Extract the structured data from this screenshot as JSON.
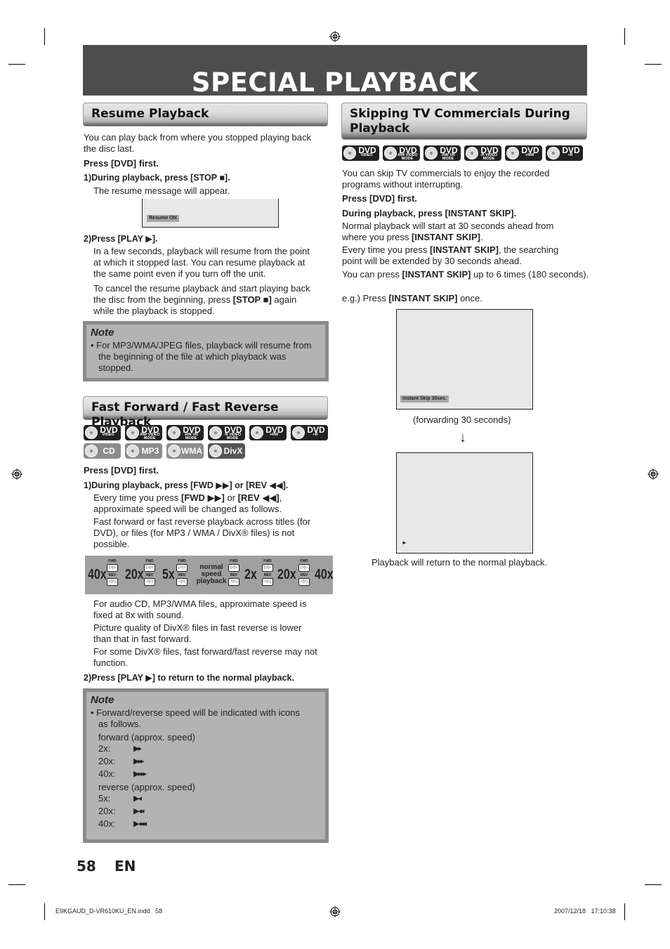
{
  "page": {
    "title": "SPECIAL PLAYBACK",
    "page_number": "58",
    "language": "EN"
  },
  "footer": {
    "file": "E9KGAUD_D-VR610KU_EN.indd   58",
    "timestamp": "2007/12/18   17:10:38"
  },
  "resume": {
    "heading": "Resume Playback",
    "intro_1": "You can play back from where you stopped playing back",
    "intro_2": "the disc last.",
    "press_first": "Press [DVD] first.",
    "step1": "1)During playback, press [STOP ■].",
    "step1_desc": "The resume message will appear.",
    "osd": "Resume ON",
    "step2": "2)Press [PLAY ▶].",
    "step2_desc": [
      "In a few seconds, playback will resume from the point",
      "at which it stopped last. You can resume playback at",
      "the same point even if you turn off the unit."
    ],
    "cancel_1": "To cancel the resume playback and start playing back",
    "cancel_2a": "the disc from the beginning, press ",
    "cancel_2b": "[STOP ■]",
    "cancel_2c": " again",
    "cancel_3": "while the playback is stopped.",
    "note_title": "Note",
    "note_lines": [
      "• For MP3/WMA/JPEG files, playback will resume from",
      "the beginning of the file at which playback was",
      "stopped."
    ]
  },
  "ffwd": {
    "heading": "Fast Forward / Fast Reverse Playback",
    "discs_row1": [
      {
        "label": "DVD",
        "sub": "VIDEO"
      },
      {
        "label": "DVD",
        "sub": "-RW VIDEO MODE"
      },
      {
        "label": "DVD",
        "sub": "-RW VR MODE"
      },
      {
        "label": "DVD",
        "sub": "-R VIDEO MODE"
      },
      {
        "label": "DVD",
        "sub": "+RW"
      },
      {
        "label": "DVD",
        "sub": "+R"
      }
    ],
    "discs_row2": [
      {
        "label": "CD"
      },
      {
        "label": "MP3"
      },
      {
        "label": "WMA"
      },
      {
        "label": "DivX"
      }
    ],
    "press_first": "Press [DVD] first.",
    "step1": "1)During playback, press [FWD ▶▶] or [REV ◀◀].",
    "desc_1a": "Every time you press ",
    "desc_1b": "[FWD ▶▶]",
    "desc_1c": " or ",
    "desc_1d": "[REV ◀◀]",
    "desc_1e": ",",
    "desc_2": "approximate speed will be changed as follows.",
    "desc_3": "Fast forward or fast reverse playback across titles (for",
    "desc_4": "DVD), or files (for MP3 / WMA / DivX® files) is not",
    "desc_5": "possible.",
    "speeds": [
      "40x",
      "20x",
      "5x",
      "2x",
      "20x",
      "40x"
    ],
    "normal_speed": [
      "normal",
      "speed",
      "playback"
    ],
    "fwd_label": "FWD",
    "rev_label": "REV",
    "after": [
      "For audio CD, MP3/WMA files, approximate speed is",
      "fixed at 8x with sound.",
      "Picture quality of DivX® files in fast reverse is lower",
      "than that in fast forward.",
      "For some DivX® files, fast forward/fast reverse may not",
      "function."
    ],
    "step2": "2)Press [PLAY ▶] to return to the normal playback.",
    "note_title": "Note",
    "note_intro_1": "• Forward/reverse speed will be indicated with icons",
    "note_intro_2": "as follows.",
    "forward_title": "forward (approx. speed)",
    "forward": [
      {
        "speed": "2x:",
        "icon": "▶▸"
      },
      {
        "speed": "20x:",
        "icon": "▶▸▸"
      },
      {
        "speed": "40x:",
        "icon": "▶▸▸▸"
      }
    ],
    "reverse_title": "reverse (approx. speed)",
    "reverse": [
      {
        "speed": "5x:",
        "icon": "▶◂"
      },
      {
        "speed": "20x:",
        "icon": "▶◂◂"
      },
      {
        "speed": "40x:",
        "icon": "▶◂◂◂"
      }
    ]
  },
  "skip": {
    "heading_1": "Skipping TV Commercials During",
    "heading_2": "Playback",
    "discs": [
      {
        "label": "DVD",
        "sub": "VIDEO"
      },
      {
        "label": "DVD",
        "sub": "-RW VIDEO MODE"
      },
      {
        "label": "DVD",
        "sub": "-RW VR MODE"
      },
      {
        "label": "DVD",
        "sub": "-R VIDEO MODE"
      },
      {
        "label": "DVD",
        "sub": "+RW"
      },
      {
        "label": "DVD",
        "sub": "+R"
      }
    ],
    "intro_1": "You can skip TV commercials to enjoy the recorded",
    "intro_2": "programs without interrupting.",
    "press_first": "Press [DVD] first.",
    "step": "During playback, press [INSTANT SKIP].",
    "p1a": "Normal playback will start at 30 seconds ahead from",
    "p1b": "where you press ",
    "p1c": "[INSTANT SKIP]",
    "p1d": ".",
    "p2a": "Every time you press ",
    "p2b": "[INSTANT SKIP]",
    "p2c": ", the searching",
    "p2d": "point will be extended by 30 seconds ahead.",
    "p3a": "You can press ",
    "p3b": "[INSTANT SKIP]",
    "p3c": " up to 6 times (180 seconds).",
    "eg_a": "e.g.) Press ",
    "eg_b": "[INSTANT SKIP]",
    "eg_c": " once.",
    "osd": "Instant Skip 30sec.",
    "caption_1": "(forwarding 30 seconds)",
    "arrow": "↓",
    "play_osd": "►",
    "caption_2": "Playback will return to the normal playback."
  }
}
